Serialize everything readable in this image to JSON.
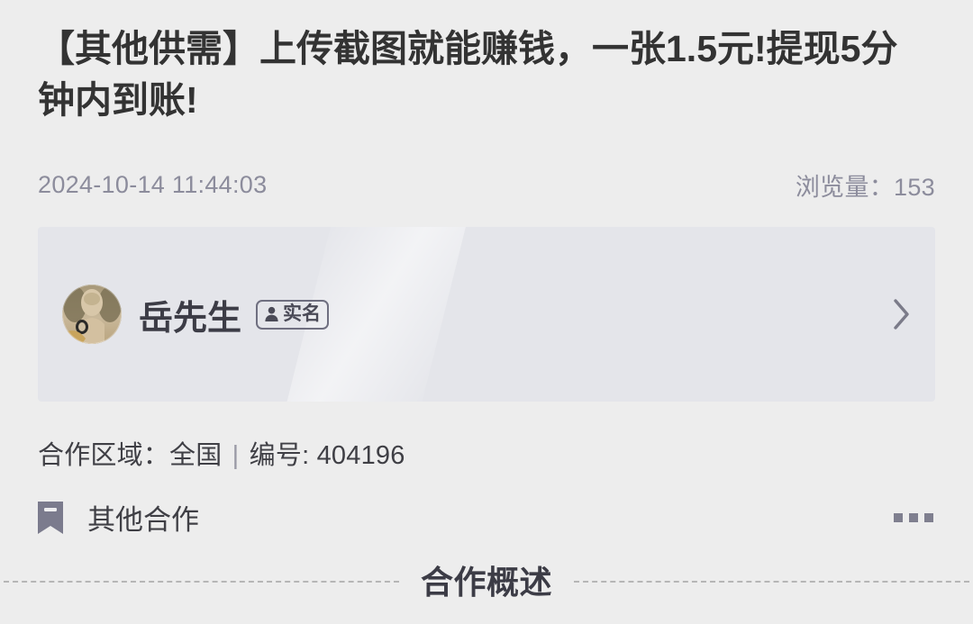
{
  "post": {
    "title": "【其他供需】上传截图就能赚钱，一张1.5元!提现5分钟内到账!",
    "timestamp": "2024-10-14 11:44:03",
    "views_label": "浏览量：153"
  },
  "user_card": {
    "name": "岳先生",
    "verified_badge": "实名",
    "chevron_icon": "chevron-right-icon",
    "avatar_icon": "user-avatar-photo"
  },
  "info": {
    "region_label": "合作区域：全国",
    "separator": "|",
    "id_label": "编号: 404196"
  },
  "category": {
    "icon": "bookmark-icon",
    "label": "其他合作",
    "more_icon": "more-options-icon"
  },
  "section": {
    "title": "合作概述"
  },
  "colors": {
    "page_background": "#ededed",
    "card_background": "#e4e5ea",
    "title_text": "#333333",
    "meta_text": "#8c8c9c",
    "body_text": "#3f3f45",
    "icon_gray": "#7f7f8f"
  }
}
